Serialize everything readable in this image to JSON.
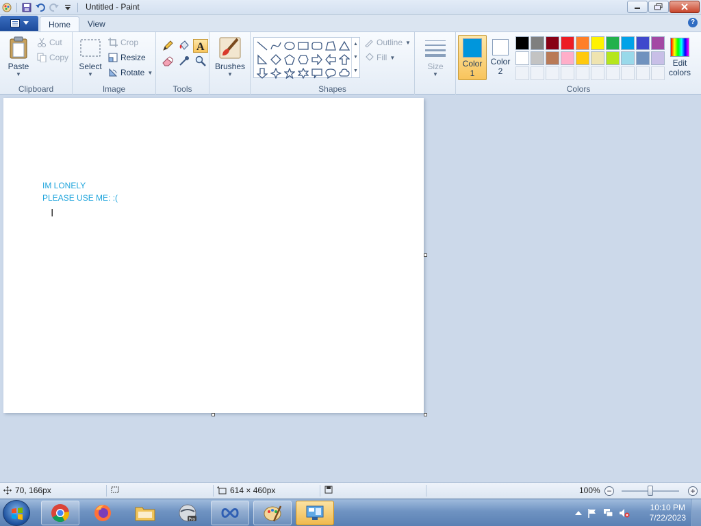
{
  "window": {
    "title": "Untitled - Paint"
  },
  "tabs": {
    "home": "Home",
    "view": "View"
  },
  "ribbon": {
    "clipboard": {
      "label": "Clipboard",
      "paste": "Paste",
      "cut": "Cut",
      "copy": "Copy"
    },
    "image": {
      "label": "Image",
      "select": "Select",
      "crop": "Crop",
      "resize": "Resize",
      "rotate": "Rotate"
    },
    "tools": {
      "label": "Tools"
    },
    "brushes": {
      "label": "Brushes"
    },
    "shapes": {
      "label": "Shapes",
      "outline": "Outline",
      "fill": "Fill"
    },
    "size": {
      "label": "Size"
    },
    "colors": {
      "label": "Colors",
      "color1_line1": "Color",
      "color1_line2": "1",
      "color2_line1": "Color",
      "color2_line2": "2",
      "edit_line1": "Edit",
      "edit_line2": "colors",
      "color1_value": "#0096dc",
      "color2_value": "#ffffff",
      "palette_row1": [
        "#000000",
        "#7f7f7f",
        "#880015",
        "#ed1c24",
        "#ff7f27",
        "#fff200",
        "#22b14c",
        "#00a2e8",
        "#3f48cc",
        "#a349a4"
      ],
      "palette_row2": [
        "#ffffff",
        "#c3c3c3",
        "#b97a57",
        "#ffaec9",
        "#ffc90e",
        "#efe4b0",
        "#b5e61d",
        "#99d9ea",
        "#7092be",
        "#c8bfe7"
      ]
    }
  },
  "canvas": {
    "text_line1": "IM LONELY",
    "text_line2": "PLEASE USE ME: :(",
    "text_color": "#1ea4dc"
  },
  "statusbar": {
    "cursor_position": "70, 166px",
    "image_size": "614 × 460px",
    "zoom": "100%"
  },
  "taskbar": {
    "time": "10:10 PM",
    "date": "7/22/2023"
  }
}
